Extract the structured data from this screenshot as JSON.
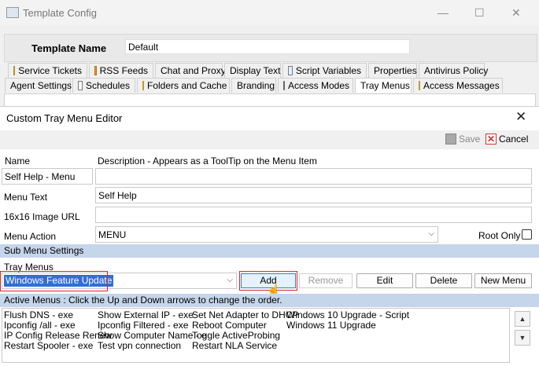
{
  "outer_window": {
    "title": "Template Config",
    "template_name_label": "Template Name",
    "template_name_value": "Default",
    "tabs_row1": [
      {
        "label": "Service Tickets",
        "icon": "ticket-icon"
      },
      {
        "label": "RSS Feeds",
        "icon": "rss-icon"
      },
      {
        "label": "Chat and Proxy",
        "icon": ""
      },
      {
        "label": "Display Text",
        "icon": ""
      },
      {
        "label": "Script Variables",
        "icon": "script-icon"
      },
      {
        "label": "Properties",
        "icon": ""
      },
      {
        "label": "Antivirus Policy",
        "icon": ""
      }
    ],
    "tabs_row2": [
      {
        "label": "Agent Settings",
        "icon": ""
      },
      {
        "label": "Schedules",
        "icon": "schedule-icon"
      },
      {
        "label": "Folders and Cache",
        "icon": "folder-icon"
      },
      {
        "label": "Branding",
        "icon": ""
      },
      {
        "label": "Access Modes",
        "icon": "gear-icon"
      },
      {
        "label": "Tray Menus",
        "icon": ""
      },
      {
        "label": "Access Messages",
        "icon": "message-icon"
      }
    ],
    "active_tab": "Tray Menus"
  },
  "dialog": {
    "title": "Custom Tray Menu Editor",
    "close_glyph": "✕",
    "toolbar": {
      "save_label": "Save",
      "cancel_label": "Cancel"
    },
    "name_header": "Name",
    "description_header": "Description - Appears as a ToolTip on the Menu Item",
    "name_value": "Self Help - Menu",
    "description_value": "",
    "menu_text_label": "Menu Text",
    "menu_text_value": "Self Help",
    "image_url_label": "16x16 Image URL",
    "image_url_value": "",
    "menu_action_label": "Menu Action",
    "menu_action_value": "MENU",
    "root_only_label": "Root Only",
    "root_only_checked": false,
    "sub_menu_header": "Sub Menu Settings",
    "tray_menus_label": "Tray Menus",
    "tray_menu_selected": "Windows Feature Update",
    "buttons": {
      "add": "Add",
      "remove": "Remove",
      "edit": "Edit",
      "delete": "Delete",
      "new_menu": "New Menu"
    },
    "active_menus_header": "Active Menus : Click the Up and Down arrows to change the order.",
    "active_menus_columns": [
      [
        "Flush DNS - exe",
        "Ipconfig /all - exe",
        "IP Config Release Renew",
        "Restart Spooler - exe"
      ],
      [
        "Show External IP - exe",
        "Ipconfig Filtered - exe",
        "Show Computer Name - e",
        "Test vpn connection"
      ],
      [
        "Set Net Adapter to DHCP",
        "Reboot Computer",
        "Toggle ActiveProbing",
        "Restart NLA Service"
      ],
      [
        "Windows 10 Upgrade - Script",
        "Windows 11 Upgrade"
      ]
    ],
    "highlight_color": "#d9262c",
    "section_color": "#c5d5ea"
  }
}
